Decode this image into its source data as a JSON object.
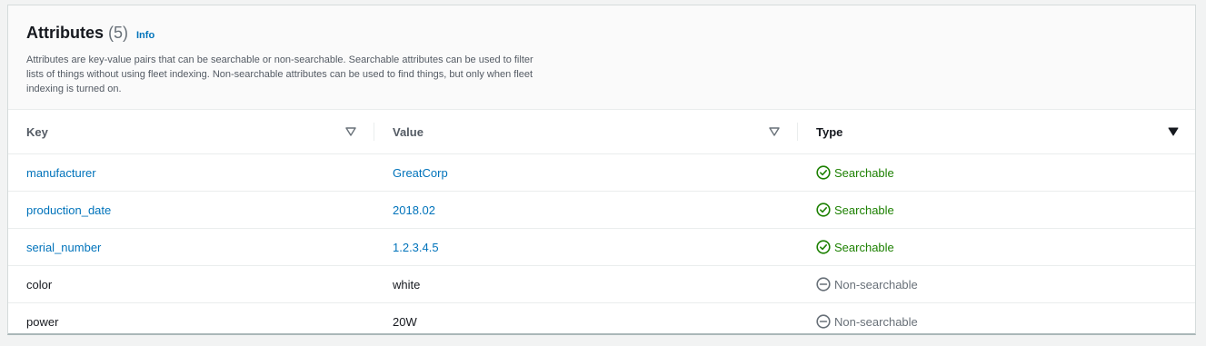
{
  "section": {
    "title": "Attributes",
    "count": "(5)",
    "info_label": "Info",
    "description": "Attributes are key-value pairs that can be searchable or non-searchable. Searchable attributes can be used to filter lists of things without using fleet indexing. Non-searchable attributes can be used to find things, but only when fleet indexing is turned on."
  },
  "table": {
    "columns": [
      "Key",
      "Value",
      "Type"
    ],
    "rows": [
      {
        "key": "manufacturer",
        "value": "GreatCorp",
        "type": "Searchable"
      },
      {
        "key": "production_date",
        "value": "2018.02",
        "type": "Searchable"
      },
      {
        "key": "serial_number",
        "value": "1.2.3.4.5",
        "type": "Searchable"
      },
      {
        "key": "color",
        "value": "white",
        "type": "Non-searchable"
      },
      {
        "key": "power",
        "value": "20W",
        "type": "Non-searchable"
      }
    ]
  },
  "colors": {
    "link": "#0073bb",
    "searchable": "#1d8102",
    "non_searchable": "#687078"
  },
  "icons": {
    "searchable": "check-circle-icon",
    "non_searchable": "minus-circle-icon",
    "sort_inactive": "sort-down-outline-icon",
    "sort_active": "sort-down-filled-icon"
  }
}
